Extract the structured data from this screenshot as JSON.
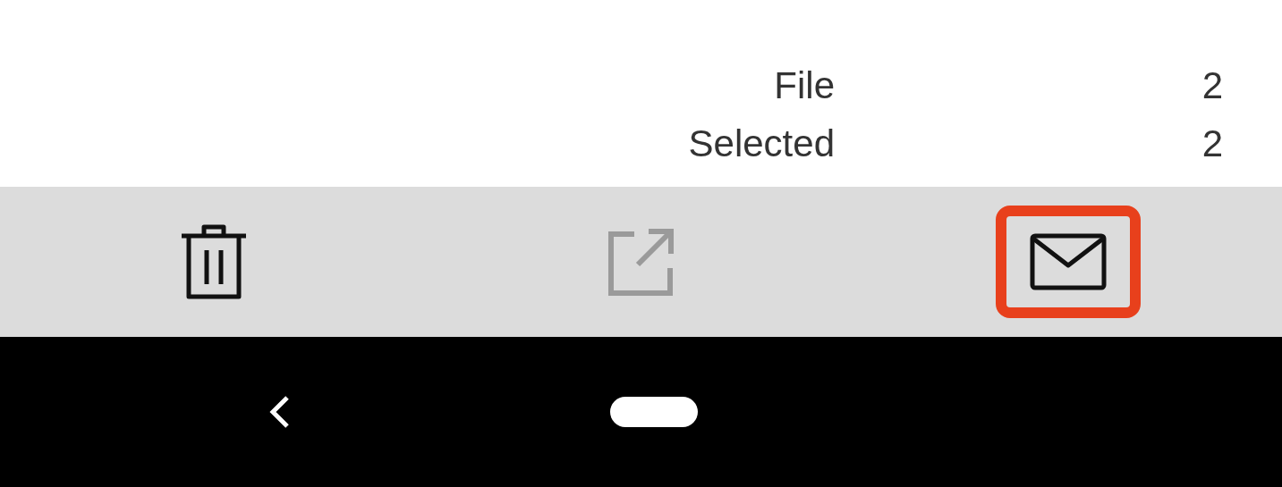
{
  "summary": [
    {
      "label": "File",
      "value": "2"
    },
    {
      "label": "Selected",
      "value": "2"
    }
  ],
  "toolbar": [
    {
      "kind": "delete",
      "disabled": false,
      "highlighted": false
    },
    {
      "kind": "share",
      "disabled": true,
      "highlighted": false
    },
    {
      "kind": "mail",
      "disabled": false,
      "highlighted": true
    }
  ]
}
